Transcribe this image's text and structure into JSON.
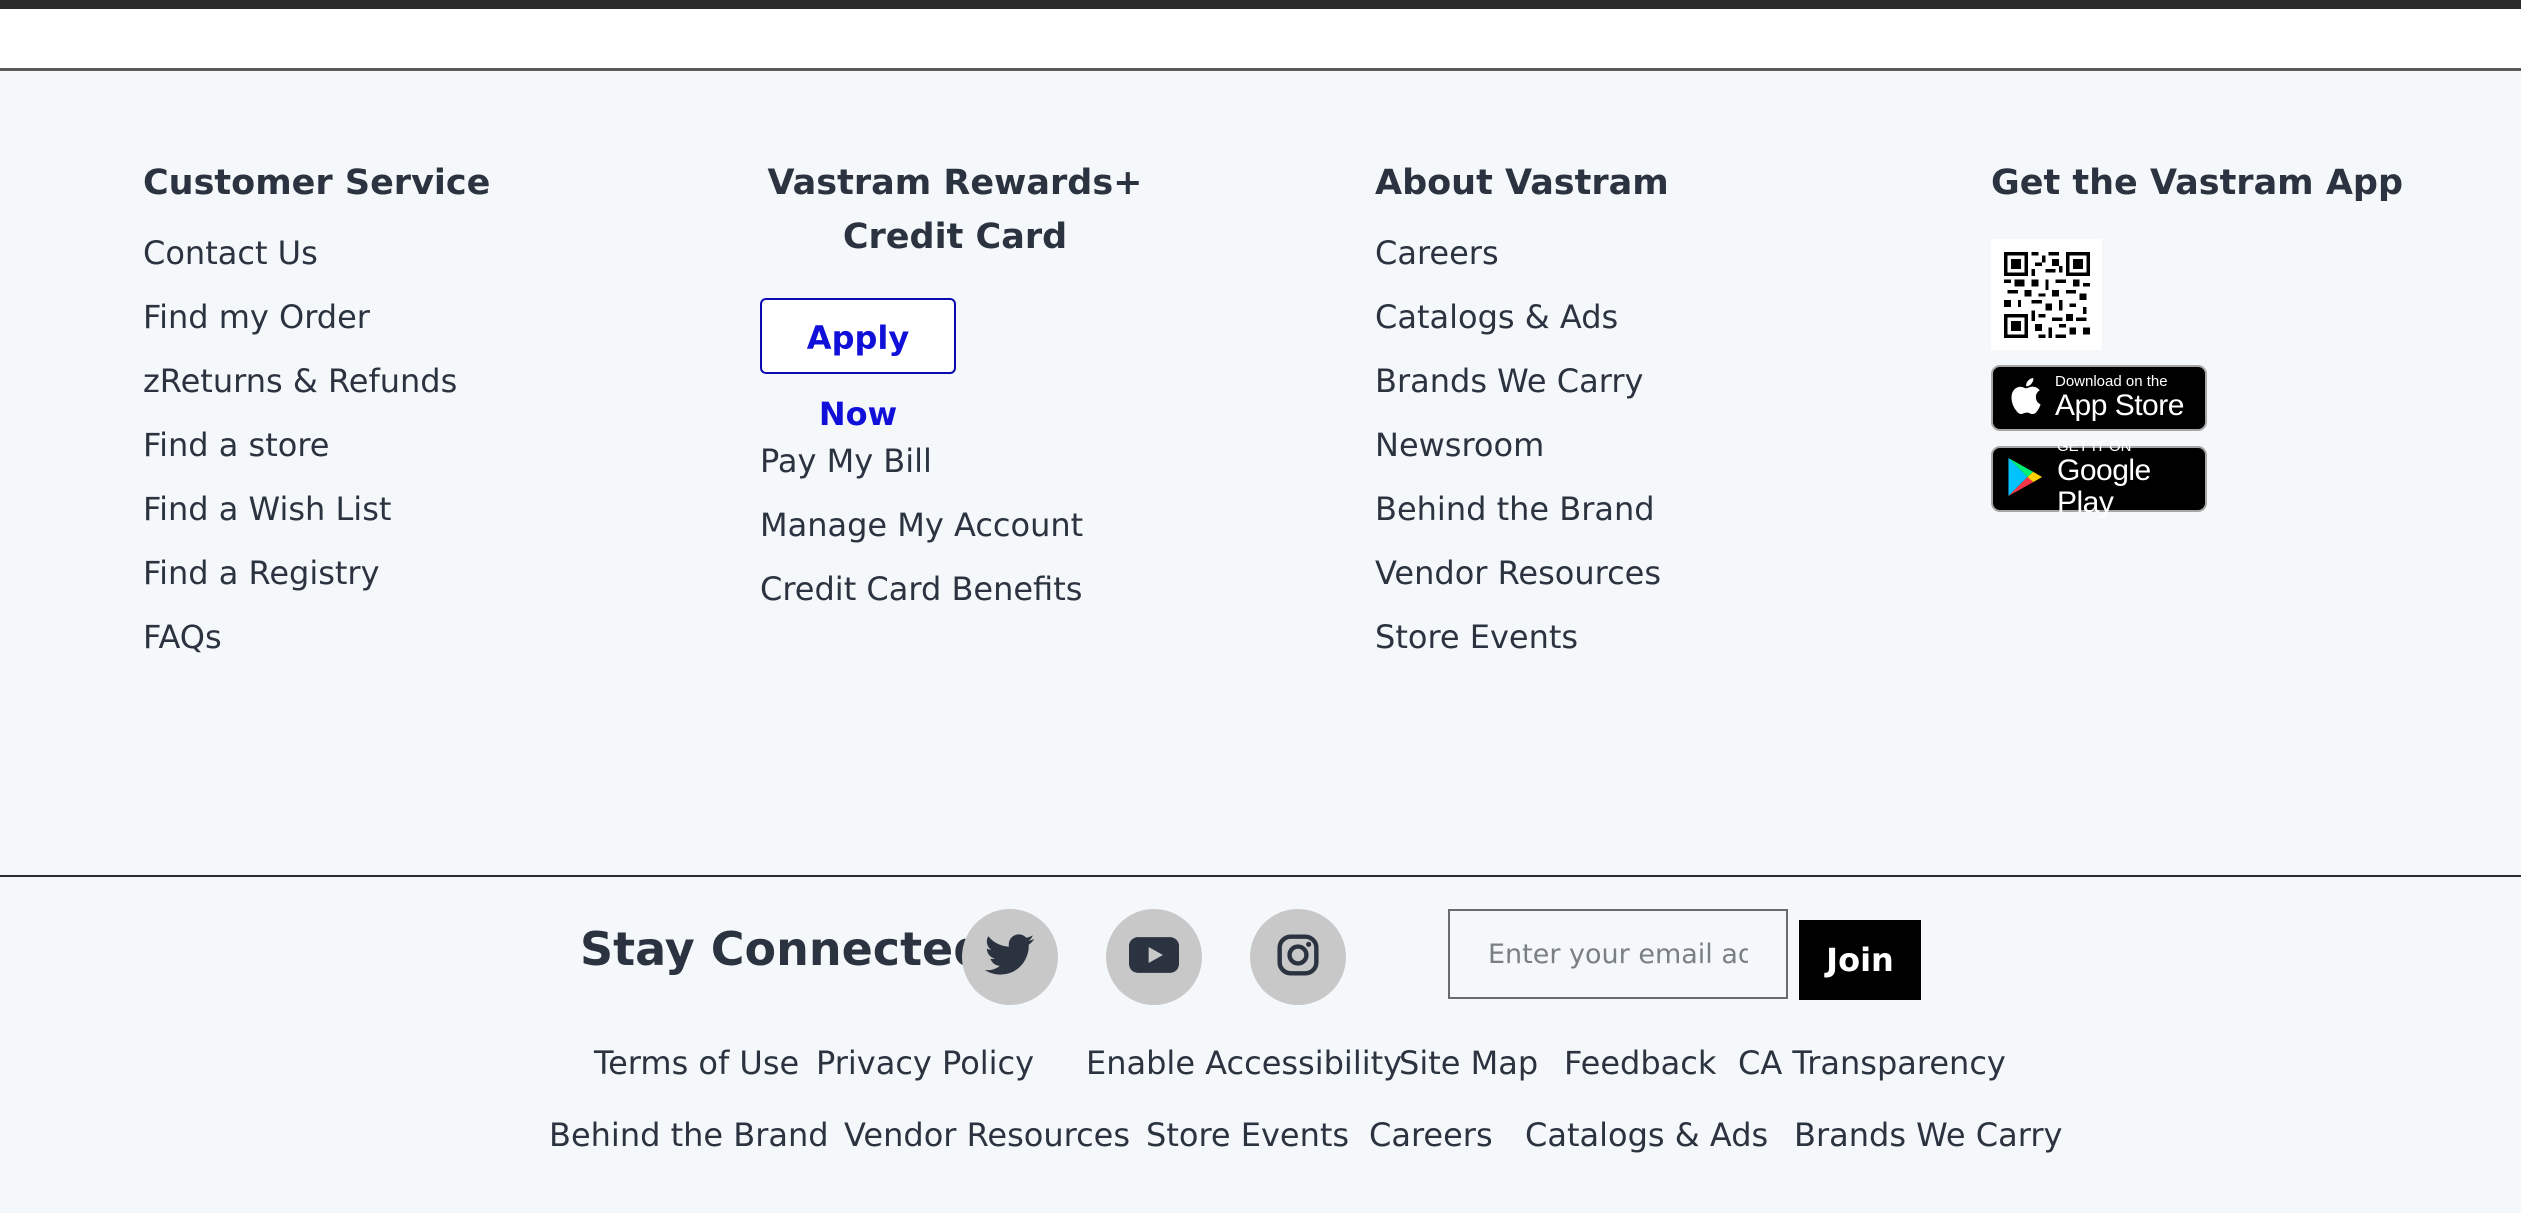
{
  "columns": {
    "customer_service": {
      "title": "Customer Service",
      "links": [
        "Contact Us",
        "Find my Order",
        "zReturns & Refunds",
        "Find a store",
        "Find a Wish List",
        "Find a Registry",
        "FAQs"
      ]
    },
    "rewards": {
      "title_line1": "Vastram Rewards+",
      "title_line2": "Credit Card",
      "apply_label": "Apply Now",
      "links": [
        "Pay My Bill",
        "Manage My Account",
        "Credit Card Benefits"
      ]
    },
    "about": {
      "title": "About Vastram",
      "links": [
        "Careers",
        "Catalogs & Ads",
        "Brands We Carry",
        "Newsroom",
        "Behind the Brand",
        "Vendor Resources",
        "Store Events"
      ]
    },
    "app": {
      "title": "Get the Vastram App",
      "app_store": {
        "small": "Download on the",
        "big": "App Store",
        "icon": "apple-icon"
      },
      "google_play": {
        "small": "GET IT ON",
        "big": "Google Play",
        "icon": "google-play-icon"
      },
      "qr_icon": "qr-code-icon"
    }
  },
  "stay_connected": {
    "title": "Stay Connected",
    "social": [
      "twitter-icon",
      "youtube-icon",
      "instagram-icon"
    ],
    "email_placeholder": "Enter your email address",
    "join_label": "Join"
  },
  "footer_links_row1": [
    "Terms of Use",
    "Privacy Policy",
    "Enable Accessibility",
    "Site Map",
    "Feedback",
    "CA Transparency"
  ],
  "footer_links_row2": [
    "Behind the Brand",
    "Vendor Resources",
    "Store Events",
    "Careers",
    "Catalogs & Ads",
    "Brands We Carry"
  ],
  "colors": {
    "apply_border": "#0a0ab0",
    "apply_text": "#1010d8",
    "join_bg": "#000000",
    "social_bg": "#c8c8c8",
    "page_bg": "#f5f8fa"
  }
}
